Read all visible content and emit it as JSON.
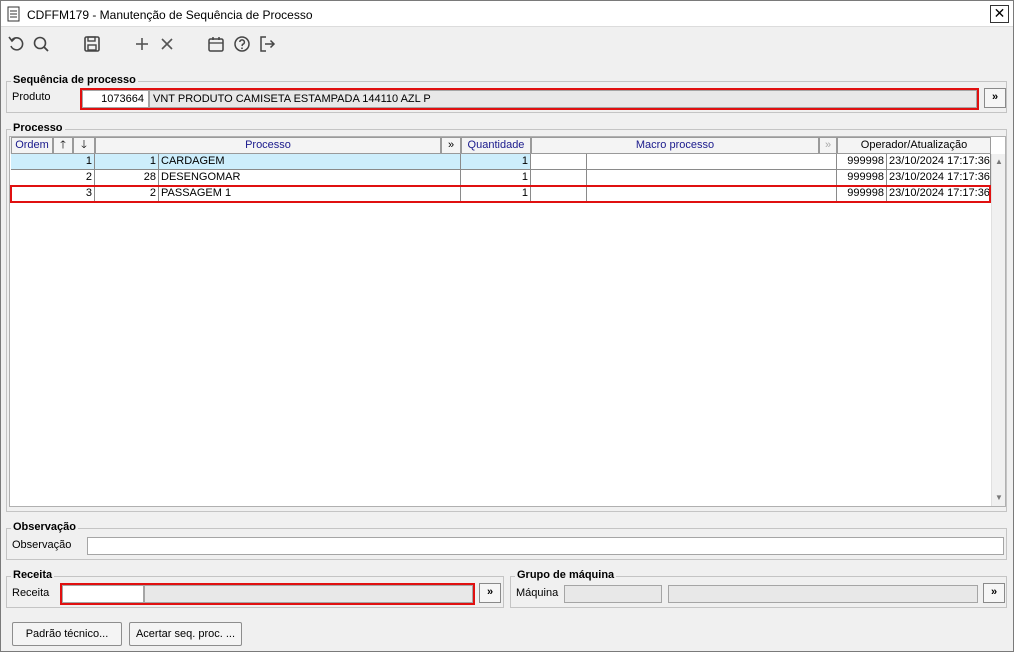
{
  "window": {
    "title": "CDFFM179 - Manutenção de Sequência de Processo",
    "close_label": "✕"
  },
  "toolbar": {
    "icons": [
      "undo-icon",
      "search-icon",
      "save-icon",
      "add-icon",
      "delete-icon",
      "calendar-icon",
      "help-icon",
      "exit-icon"
    ]
  },
  "sequencia": {
    "legend": "Sequência de processo",
    "produto_label": "Produto",
    "produto_code": "1073664",
    "produto_desc": "VNT PRODUTO CAMISETA ESTAMPADA 144110 AZL P",
    "lookup_label": "»"
  },
  "processo": {
    "legend": "Processo",
    "headers": {
      "ordem": "Ordem",
      "up": "🡑",
      "down": "🡓",
      "processo": "Processo",
      "expand": "»",
      "quantidade": "Quantidade",
      "macro": "Macro processo",
      "operador": "Operador/Atualização"
    },
    "rows": [
      {
        "ordem": "1",
        "codigo": "1",
        "processo": "CARDAGEM",
        "quantidade": "1",
        "macro_code": "",
        "macro_desc": "",
        "operador": "999998",
        "data": "23/10/2024 17:17:36"
      },
      {
        "ordem": "2",
        "codigo": "28",
        "processo": "DESENGOMAR",
        "quantidade": "1",
        "macro_code": "",
        "macro_desc": "",
        "operador": "999998",
        "data": "23/10/2024 17:17:36"
      },
      {
        "ordem": "3",
        "codigo": "2",
        "processo": "PASSAGEM 1",
        "quantidade": "1",
        "macro_code": "",
        "macro_desc": "",
        "operador": "999998",
        "data": "23/10/2024 17:17:36"
      }
    ]
  },
  "observacao": {
    "legend": "Observação",
    "label": "Observação",
    "value": ""
  },
  "receita": {
    "legend": "Receita",
    "label": "Receita",
    "code": "",
    "desc": "",
    "lookup_label": "»"
  },
  "grupo": {
    "legend": "Grupo de máquina",
    "label": "Máquina",
    "code": "",
    "desc": "",
    "lookup_label": "»"
  },
  "buttons": {
    "padrao": "Padrão técnico...",
    "acertar": "Acertar seq. proc. ..."
  },
  "colors": {
    "highlight": "#e01010",
    "selected_row": "#cdeefc",
    "header_text": "#1a1a8c"
  }
}
